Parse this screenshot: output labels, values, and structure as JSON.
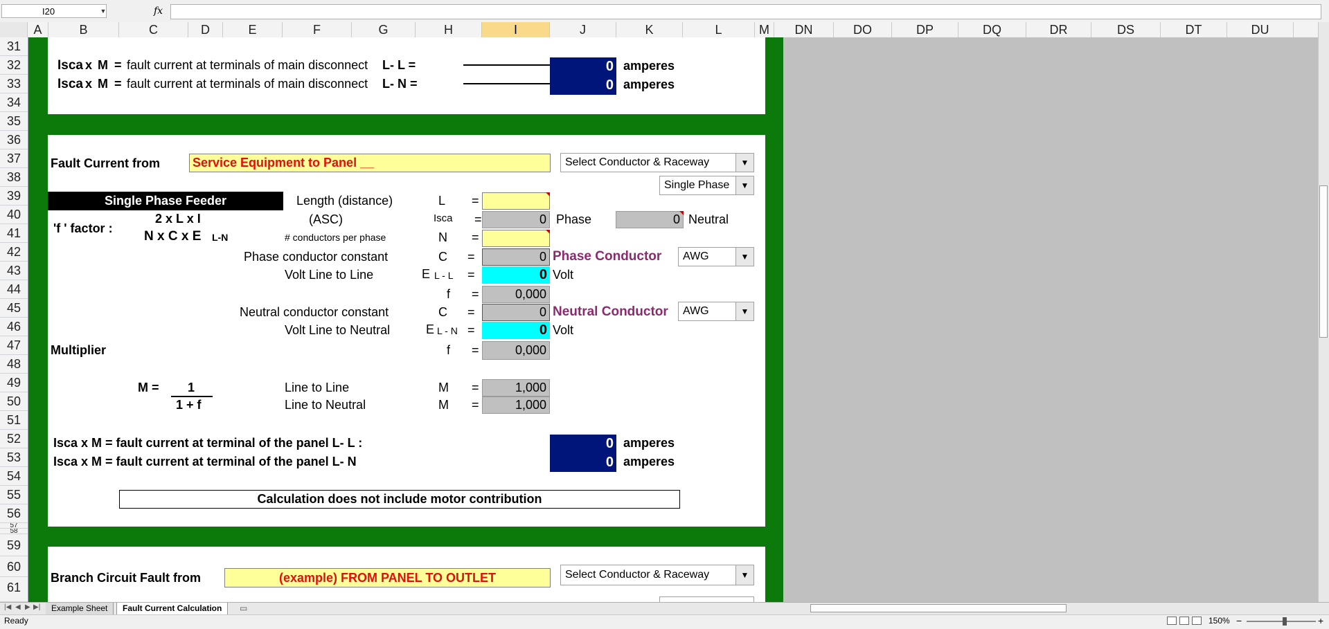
{
  "formula_bar": {
    "cell_ref": "I20",
    "fx": "fx",
    "formula": ""
  },
  "columns": [
    "A",
    "B",
    "C",
    "D",
    "E",
    "F",
    "G",
    "H",
    "I",
    "J",
    "K",
    "L",
    "M",
    "DN",
    "DO",
    "DP",
    "DQ",
    "DR",
    "DS",
    "DT",
    "DU"
  ],
  "rows": [
    "31",
    "32",
    "33",
    "34",
    "35",
    "36",
    "37",
    "38",
    "39",
    "40",
    "41",
    "42",
    "43",
    "44",
    "45",
    "46",
    "47",
    "48",
    "49",
    "50",
    "51",
    "52",
    "53",
    "54",
    "55",
    "56",
    "57",
    "58",
    "59",
    "60",
    "61"
  ],
  "section1": {
    "line1": {
      "isca": "Isca",
      "x": "x",
      "m": "M",
      "eq": "=",
      "text": "fault current at terminals of main disconnect",
      "suffix": "L- L =",
      "value": "0",
      "unit": "amperes"
    },
    "line2": {
      "isca": "Isca",
      "x": "x",
      "m": "M",
      "eq": "=",
      "text": "fault current at terminals of main disconnect",
      "suffix": "L- N =",
      "value": "0",
      "unit": "amperes"
    }
  },
  "section2": {
    "fault_current_from": "Fault Current from",
    "panel_name": "Service Equipment to Panel __",
    "select_conductor": "Select Conductor & Raceway",
    "phase_select": "Single Phase",
    "feeder_title": "Single Phase Feeder",
    "f_factor": "'f ' factor :",
    "formula_num": "2 x L x I",
    "formula_den": "N x C x E",
    "formula_den_sub": "L-N",
    "length_label": "Length (distance)",
    "length_sym": "L",
    "asc_label": "(ASC)",
    "isca_sym": "Isca",
    "isca_value": "0",
    "phase_label": "Phase",
    "neutral_value": "0",
    "neutral_label": "Neutral",
    "cond_per_phase_label": "# conductors per phase",
    "n_sym": "N",
    "phase_const_label": "Phase conductor constant",
    "c_sym": "C",
    "phase_const_value": "0",
    "phase_conductor_label": "Phase Conductor",
    "awg1": "AWG",
    "volt_ll_label": "Volt Line to Line",
    "e_sym": "E",
    "e_ll_sub": "L - L",
    "volt_ll_value": "0",
    "volt_unit": "Volt",
    "f_sym": "f",
    "f_value1": "0,000",
    "neutral_const_label": "Neutral conductor constant",
    "neutral_const_value": "0",
    "neutral_conductor_label": "Neutral Conductor",
    "awg2": "AWG",
    "volt_ln_label": "Volt Line to Neutral",
    "e_ln_sub": "L - N",
    "volt_ln_value": "0",
    "multiplier_label": "Multiplier",
    "f_value2": "0,000",
    "m_formula_lhs": "M =",
    "m_formula_num": "1",
    "m_formula_den": "1 + f",
    "m_ll_label": "Line to Line",
    "m_sym": "M",
    "m_ll_value": "1,000",
    "m_ln_label": "Line to Neutral",
    "m_ln_value": "1,000",
    "result_ll_text": "Isca  x  M  =  fault current at terminal of the panel L- L :",
    "result_ll_value": "0",
    "result_ln_text": "Isca  x  M  =  fault current at terminal of the panel L- N",
    "result_ln_value": "0",
    "amperes": "amperes",
    "note": "Calculation does not include motor contribution",
    "eq": "="
  },
  "section3": {
    "label": "Branch Circuit Fault from",
    "panel_name": "(example) FROM PANEL TO OUTLET",
    "select_conductor": "Select Conductor & Raceway"
  },
  "tabs": [
    "Example Sheet",
    "Fault Current Calculation"
  ],
  "status": {
    "ready": "Ready",
    "zoom": "150%"
  },
  "colors": {
    "green": "#0b7a0b",
    "navy": "#00157a",
    "yellow": "#ffff99",
    "cyan": "#00ffff",
    "red_text": "#e01010",
    "purple_text": "#8b2a6e"
  }
}
